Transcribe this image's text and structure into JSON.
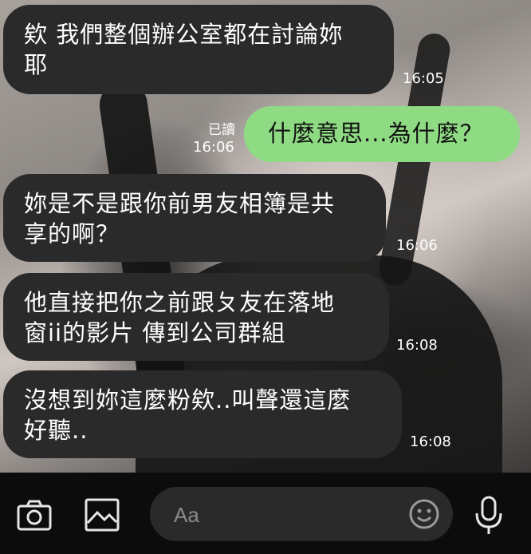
{
  "messages": [
    {
      "direction": "in",
      "text_lines": [
        "欸 我們整個辦公室都在討論妳",
        "耶"
      ],
      "time": "16:05"
    },
    {
      "direction": "out",
      "text_lines": [
        "什麼意思...為什麼？"
      ],
      "time": "16:06",
      "read": "已讀"
    },
    {
      "direction": "in",
      "text_lines": [
        "妳是不是跟你前男友相簿是共",
        "享的啊？"
      ],
      "time": "16:06"
    },
    {
      "direction": "in",
      "text_lines": [
        "他直接把你之前跟ㄆ友在落地",
        "窗ii的影片 傳到公司群組"
      ],
      "time": "16:08"
    },
    {
      "direction": "in",
      "text_lines": [
        "沒想到妳這麼粉欸..叫聲還這麼",
        "好聽.."
      ],
      "time": "16:08"
    }
  ],
  "input_bar": {
    "placeholder": "Aa",
    "icons": [
      "camera-icon",
      "image-icon",
      "emoji-icon",
      "microphone-icon"
    ]
  },
  "colors": {
    "incoming_bubble": "#2a2a2a",
    "outgoing_bubble": "#8fdb84",
    "bottom_bar": "#0c0c0c"
  }
}
